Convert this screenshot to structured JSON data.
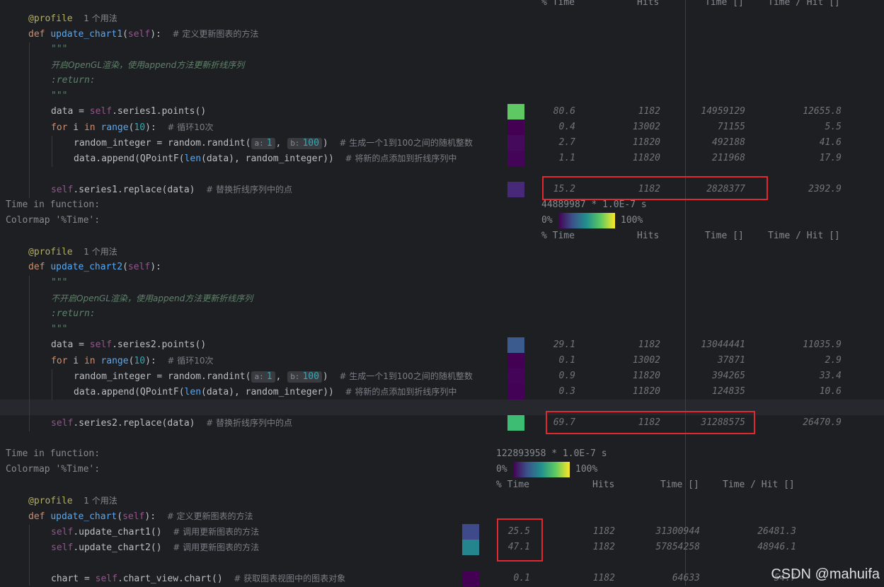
{
  "header1": {
    "pct": "% Time",
    "hits": "Hits",
    "time": "Time []",
    "per_hit": "Time / Hit []"
  },
  "block1": {
    "decorator": "@profile",
    "usages": "1 个用法",
    "def_kw": "def",
    "func": "update_chart1",
    "open_paren": "(",
    "self": "self",
    "close_sig": "):",
    "comment": "# 定义更新图表的方法",
    "doc_open": "\"\"\"",
    "doc_line": "开启OpenGL渲染，使用append方法更新折线序列",
    "doc_return": ":return:",
    "doc_close": "\"\"\"",
    "lines": [
      {
        "pre": "data = ",
        "self": "self",
        "post": ".series1.points()",
        "pct": "80.6",
        "hits": "1182",
        "time": "14959129",
        "per_hit": "12655.8",
        "color": "#5ec962"
      },
      {
        "for_kw": "for",
        "mid": " i ",
        "in_kw": "in",
        "range": "range",
        "paren_open": "(",
        "num": "10",
        "paren_close": "):",
        "comment": "# 循环10次",
        "pct": "0.4",
        "hits": "13002",
        "time": "71155",
        "per_hit": "5.5",
        "color": "#440154"
      },
      {
        "pre": "random_integer = random.randint(",
        "hint_a": "a:",
        "val_a": "1",
        "sep": ",",
        "hint_b": "b:",
        "val_b": "100",
        "post": ")",
        "comment": "# 生成一个1到100之间的随机整数",
        "pct": "2.7",
        "hits": "11820",
        "time": "492188",
        "per_hit": "41.6",
        "color": "#450a5c"
      },
      {
        "pre": "data.append(QPointF(",
        "len": "len",
        "post": "(data), random_integer))",
        "comment": "# 将新的点添加到折线序列中",
        "pct": "1.1",
        "hits": "11820",
        "time": "211968",
        "per_hit": "17.9",
        "color": "#440457"
      },
      {
        "self": "self",
        "post": ".series1.replace(data)",
        "comment": "# 替换折线序列中的点",
        "pct": "15.2",
        "hits": "1182",
        "time": "2828377",
        "per_hit": "2392.9",
        "color": "#482878"
      }
    ],
    "time_label": "Time in function:",
    "time_value": "44889987 * 1.0E-7 s",
    "colormap_label": "Colormap '%Time':",
    "cmap_min": "0%",
    "cmap_max": "100%"
  },
  "header2": {
    "pct": "% Time",
    "hits": "Hits",
    "time": "Time []",
    "per_hit": "Time / Hit []"
  },
  "block2": {
    "decorator": "@profile",
    "usages": "1 个用法",
    "def_kw": "def",
    "func": "update_chart2",
    "open_paren": "(",
    "self": "self",
    "close_sig": "):",
    "doc_open": "\"\"\"",
    "doc_line": "不开启OpenGL渲染，使用append方法更新折线序列",
    "doc_return": ":return:",
    "doc_close": "\"\"\"",
    "lines": [
      {
        "pre": "data = ",
        "self": "self",
        "post": ".series2.points()",
        "pct": "29.1",
        "hits": "1182",
        "time": "13044441",
        "per_hit": "11035.9",
        "color": "#3b5b8f"
      },
      {
        "for_kw": "for",
        "mid": " i ",
        "in_kw": "in",
        "range": "range",
        "paren_open": "(",
        "num": "10",
        "paren_close": "):",
        "comment": "# 循环10次",
        "pct": "0.1",
        "hits": "13002",
        "time": "37871",
        "per_hit": "2.9",
        "color": "#440154"
      },
      {
        "pre": "random_integer = random.randint(",
        "hint_a": "a:",
        "val_a": "1",
        "sep": ",",
        "hint_b": "b:",
        "val_b": "100",
        "post": ")",
        "comment": "# 生成一个1到100之间的随机整数",
        "pct": "0.9",
        "hits": "11820",
        "time": "394265",
        "per_hit": "33.4",
        "color": "#440457"
      },
      {
        "pre": "data.append(QPointF(",
        "len": "len",
        "post": "(data), random_integer))",
        "comment": "# 将新的点添加到折线序列中",
        "pct": "0.3",
        "hits": "11820",
        "time": "124835",
        "per_hit": "10.6",
        "color": "#440256"
      },
      {
        "self": "self",
        "post": ".series2.replace(data)",
        "comment": "# 替换折线序列中的点",
        "pct": "69.7",
        "hits": "1182",
        "time": "31288575",
        "per_hit": "26470.9",
        "color": "#3dbc74"
      }
    ],
    "time_label": "Time in function:",
    "time_value": "122893958 * 1.0E-7 s",
    "colormap_label": "Colormap '%Time':",
    "cmap_min": "0%",
    "cmap_max": "100%"
  },
  "header3": {
    "pct": "% Time",
    "hits": "Hits",
    "time": "Time []",
    "per_hit": "Time / Hit []"
  },
  "block3": {
    "decorator": "@profile",
    "usages": "1 个用法",
    "def_kw": "def",
    "func": "update_chart",
    "open_paren": "(",
    "self": "self",
    "close_sig": "):",
    "comment": "# 定义更新图表的方法",
    "lines": [
      {
        "self": "self",
        "post": ".update_chart1()",
        "comment": "# 调用更新图表的方法",
        "pct": "25.5",
        "hits": "1182",
        "time": "31300944",
        "per_hit": "26481.3",
        "color": "#3e4a89"
      },
      {
        "self": "self",
        "post": ".update_chart2()",
        "comment": "# 调用更新图表的方法",
        "pct": "47.1",
        "hits": "1182",
        "time": "57854258",
        "per_hit": "48946.1",
        "color": "#25858e"
      },
      {
        "pre": "chart = ",
        "self": "self",
        "post": ".chart_view.chart()",
        "comment": "# 获取图表视图中的图表对象",
        "pct": "0.1",
        "hits": "1182",
        "time": "64633",
        "per_hit": "54.7",
        "color": "#440154"
      }
    ]
  },
  "watermark": "CSDN @mahuifa"
}
